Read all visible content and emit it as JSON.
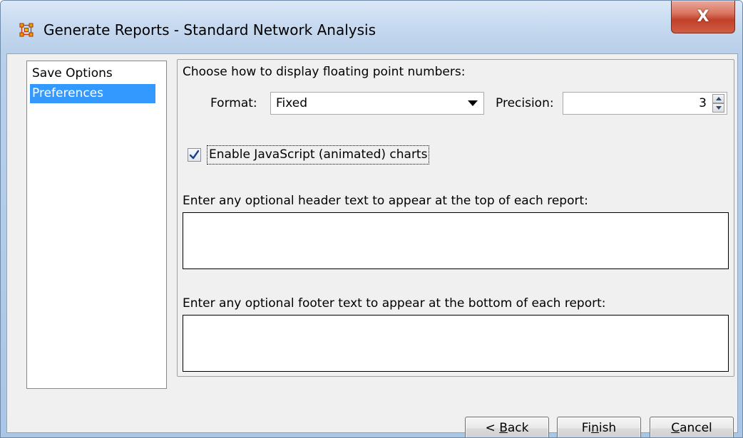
{
  "window": {
    "title": "Generate Reports - Standard Network Analysis",
    "icon": "network-nodes-icon",
    "close_label": "X",
    "accent_color": "#c1402a"
  },
  "sidebar": {
    "items": [
      {
        "label": "Save Options",
        "selected": false
      },
      {
        "label": "Preferences",
        "selected": true
      }
    ],
    "selection_color": "#3399ff"
  },
  "preferences": {
    "float_heading": "Choose how to display floating point numbers:",
    "format_label": "Format:",
    "format_value": "Fixed",
    "precision_label": "Precision:",
    "precision_value": "3",
    "js_charts_label": "Enable JavaScript (animated) charts",
    "js_charts_checked": true,
    "header_prompt": "Enter any optional header text to appear at the top of each report:",
    "header_value": "",
    "footer_prompt": "Enter any optional footer text to appear at the bottom of each report:",
    "footer_value": ""
  },
  "buttons": {
    "back": {
      "pre": "< ",
      "mnemonic": "B",
      "post": "ack"
    },
    "finish": {
      "pre": "Fi",
      "mnemonic": "n",
      "post": "ish"
    },
    "cancel": {
      "pre": "",
      "mnemonic": "C",
      "post": "ancel"
    }
  }
}
